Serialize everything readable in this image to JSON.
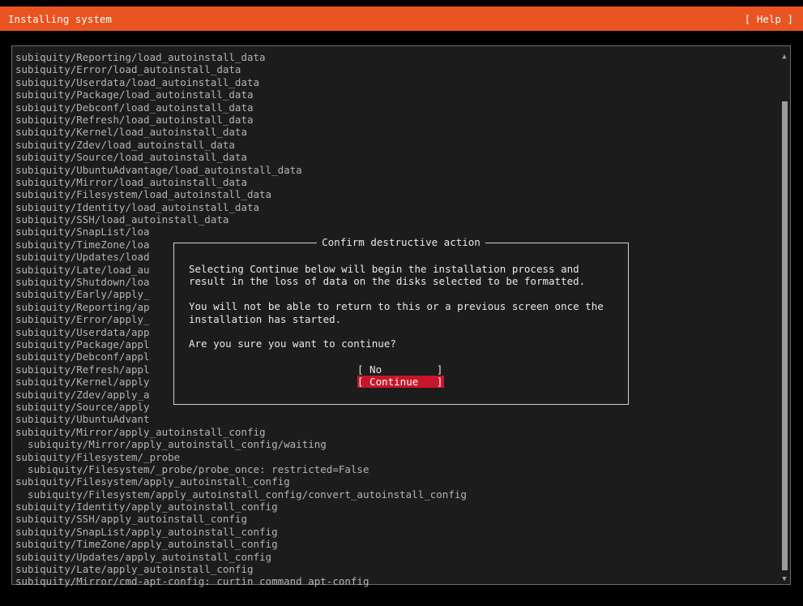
{
  "header": {
    "title": "Installing system",
    "help_label": "[ Help ]"
  },
  "log": {
    "lines": [
      "subiquity/Reporting/load_autoinstall_data",
      "subiquity/Error/load_autoinstall_data",
      "subiquity/Userdata/load_autoinstall_data",
      "subiquity/Package/load_autoinstall_data",
      "subiquity/Debconf/load_autoinstall_data",
      "subiquity/Refresh/load_autoinstall_data",
      "subiquity/Kernel/load_autoinstall_data",
      "subiquity/Zdev/load_autoinstall_data",
      "subiquity/Source/load_autoinstall_data",
      "subiquity/UbuntuAdvantage/load_autoinstall_data",
      "subiquity/Mirror/load_autoinstall_data",
      "subiquity/Filesystem/load_autoinstall_data",
      "subiquity/Identity/load_autoinstall_data",
      "subiquity/SSH/load_autoinstall_data",
      "subiquity/SnapList/loa",
      "subiquity/TimeZone/loa",
      "subiquity/Updates/load",
      "subiquity/Late/load_au",
      "subiquity/Shutdown/loa",
      "subiquity/Early/apply_",
      "subiquity/Reporting/ap",
      "subiquity/Error/apply_",
      "subiquity/Userdata/app",
      "subiquity/Package/appl",
      "subiquity/Debconf/appl",
      "subiquity/Refresh/appl",
      "subiquity/Kernel/apply",
      "subiquity/Zdev/apply_a",
      "subiquity/Source/apply",
      "subiquity/UbuntuAdvant",
      "subiquity/Mirror/apply_autoinstall_config",
      "  subiquity/Mirror/apply_autoinstall_config/waiting",
      "subiquity/Filesystem/_probe",
      "  subiquity/Filesystem/_probe/probe_once: restricted=False",
      "subiquity/Filesystem/apply_autoinstall_config",
      "  subiquity/Filesystem/apply_autoinstall_config/convert_autoinstall_config",
      "subiquity/Identity/apply_autoinstall_config",
      "subiquity/SSH/apply_autoinstall_config",
      "subiquity/SnapList/apply_autoinstall_config",
      "subiquity/TimeZone/apply_autoinstall_config",
      "subiquity/Updates/apply_autoinstall_config",
      "subiquity/Late/apply_autoinstall_config",
      "subiquity/Mirror/cmd-apt-config: curtin command apt-config"
    ]
  },
  "dialog": {
    "title": "Confirm destructive action",
    "lines": [
      "Selecting Continue below will begin the installation process and",
      "result in the loss of data on the disks selected to be formatted.",
      "",
      "You will not be able to return to this or a previous screen once the",
      "installation has started.",
      "",
      "Are you sure you want to continue?"
    ],
    "no_label": "[ No         ]",
    "continue_label": "[ Continue   ]"
  },
  "scrollbar": {
    "up_arrow": "▲",
    "down_arrow": "▼"
  },
  "colors": {
    "header_bg": "#e95420",
    "selected_button_bg": "#c7162b"
  }
}
